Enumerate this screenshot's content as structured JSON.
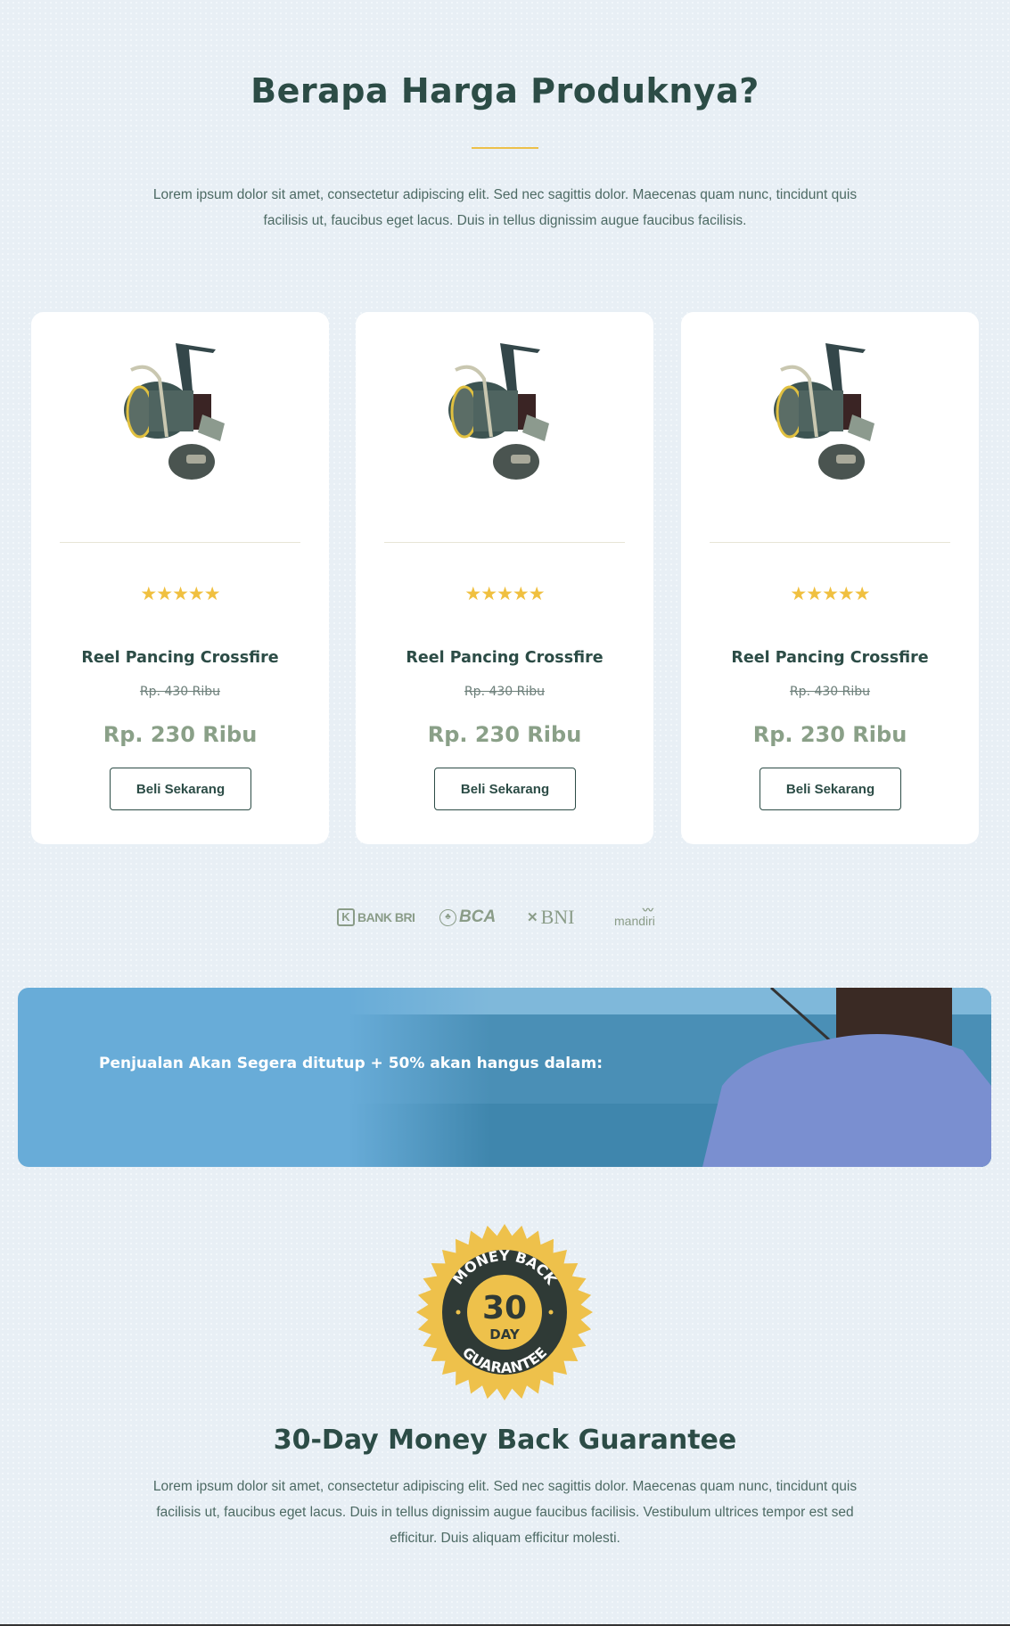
{
  "pricing": {
    "title": "Berapa Harga Produknya?",
    "intro": "Lorem ipsum dolor sit amet, consectetur adipiscing elit. Sed nec sagittis dolor. Maecenas quam nunc, tincidunt quis facilisis ut, faucibus eget lacus. Duis in tellus dignissim augue faucibus facilisis.",
    "products": [
      {
        "name": "Reel Pancing Crossfire",
        "rating": 5,
        "stars": "★★★★★",
        "old_price": "Rp. 430 Ribu",
        "price": "Rp. 230 Ribu",
        "button": "Beli Sekarang"
      },
      {
        "name": "Reel Pancing Crossfire",
        "rating": 5,
        "stars": "★★★★★",
        "old_price": "Rp. 430 Ribu",
        "price": "Rp. 230 Ribu",
        "button": "Beli Sekarang"
      },
      {
        "name": "Reel Pancing Crossfire",
        "rating": 5,
        "stars": "★★★★★",
        "old_price": "Rp. 430 Ribu",
        "price": "Rp. 230 Ribu",
        "button": "Beli Sekarang"
      }
    ]
  },
  "banks": [
    "BANK BRI",
    "BCA",
    "BNI",
    "mandiri"
  ],
  "banner": {
    "message": "Penjualan Akan Segera ditutup + 50% akan hangus dalam:"
  },
  "guarantee": {
    "badge_top": "MONEY BACK",
    "badge_number": "30",
    "badge_day": "DAY",
    "badge_bottom": "GUARANTEE",
    "title": "30-Day Money Back Guarantee",
    "text": "Lorem ipsum dolor sit amet, consectetur adipiscing elit. Sed nec sagittis dolor. Maecenas quam nunc, tincidunt quis facilisis ut, faucibus eget lacus. Duis in tellus dignissim augue faucibus facilisis. Vestibulum ultrices tempor est sed efficitur. Duis aliquam efficitur molesti."
  },
  "colors": {
    "accent": "#ecc04a",
    "heading": "#2c4c46",
    "price": "#8aa088",
    "banner": "#68acd8"
  }
}
